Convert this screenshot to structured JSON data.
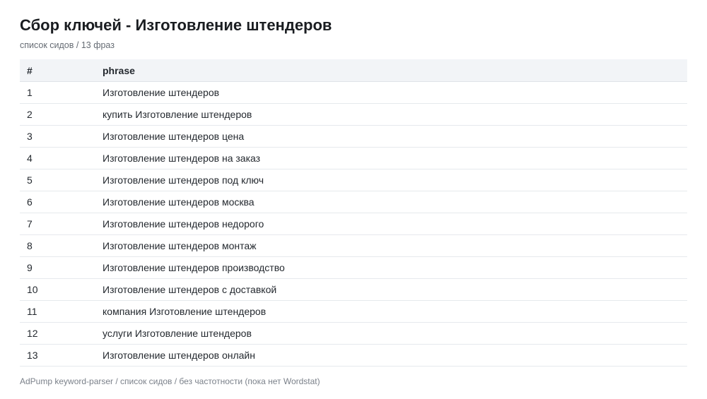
{
  "header": {
    "title": "Сбор ключей - Изготовление штендеров",
    "subtitle": "список сидов / 13 фраз"
  },
  "table": {
    "columns": [
      "#",
      "phrase"
    ],
    "rows": [
      {
        "n": "1",
        "phrase": "Изготовление штендеров"
      },
      {
        "n": "2",
        "phrase": "купить Изготовление штендеров"
      },
      {
        "n": "3",
        "phrase": "Изготовление штендеров цена"
      },
      {
        "n": "4",
        "phrase": "Изготовление штендеров на заказ"
      },
      {
        "n": "5",
        "phrase": "Изготовление штендеров под ключ"
      },
      {
        "n": "6",
        "phrase": "Изготовление штендеров москва"
      },
      {
        "n": "7",
        "phrase": "Изготовление штендеров недорого"
      },
      {
        "n": "8",
        "phrase": "Изготовление штендеров монтаж"
      },
      {
        "n": "9",
        "phrase": "Изготовление штендеров производство"
      },
      {
        "n": "10",
        "phrase": "Изготовление штендеров с доставкой"
      },
      {
        "n": "11",
        "phrase": "компания Изготовление штендеров"
      },
      {
        "n": "12",
        "phrase": "услуги Изготовление штендеров"
      },
      {
        "n": "13",
        "phrase": "Изготовление штендеров онлайн"
      }
    ]
  },
  "footer": {
    "text": "AdPump keyword-parser / список сидов / без частотности (пока нет Wordstat)"
  }
}
